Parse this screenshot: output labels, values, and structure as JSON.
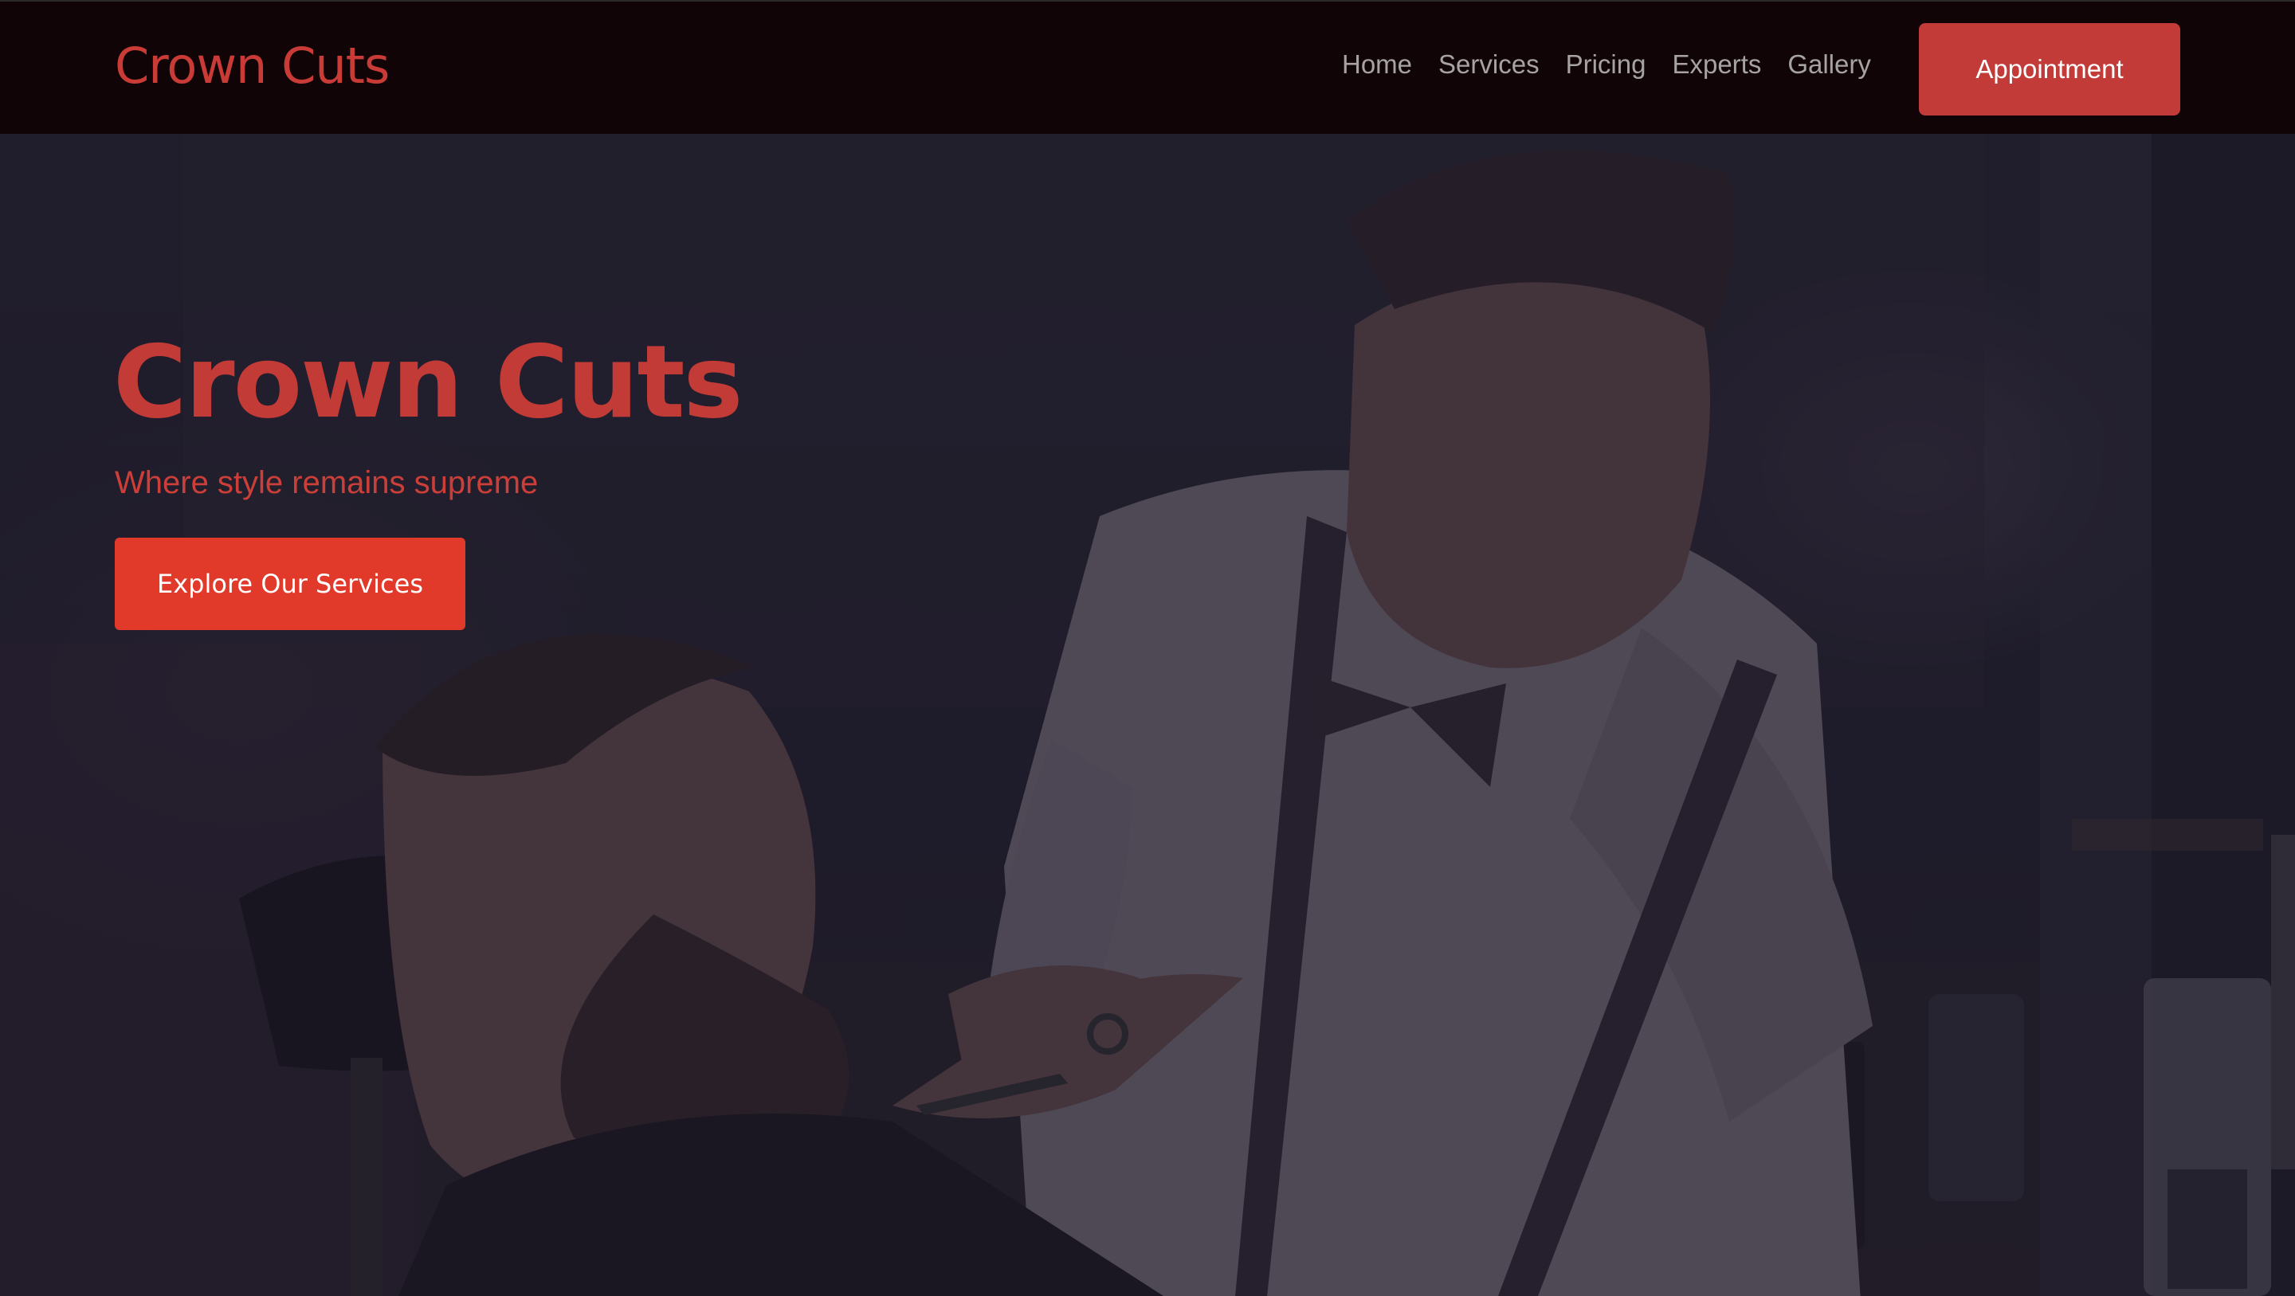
{
  "header": {
    "brand": "Crown Cuts",
    "nav": [
      {
        "label": "Home"
      },
      {
        "label": "Services"
      },
      {
        "label": "Pricing"
      },
      {
        "label": "Experts"
      },
      {
        "label": "Gallery"
      }
    ],
    "cta_label": "Appointment"
  },
  "hero": {
    "title": "Crown Cuts",
    "subtitle": "Where style remains supreme",
    "cta_label": "Explore Our Services",
    "image": "barber-trimming-beard-photo"
  },
  "colors": {
    "accent": "#c23b39",
    "cta_bright": "#e13a2b",
    "header_bg": "#100406",
    "nav_text": "#a7a3a3"
  }
}
